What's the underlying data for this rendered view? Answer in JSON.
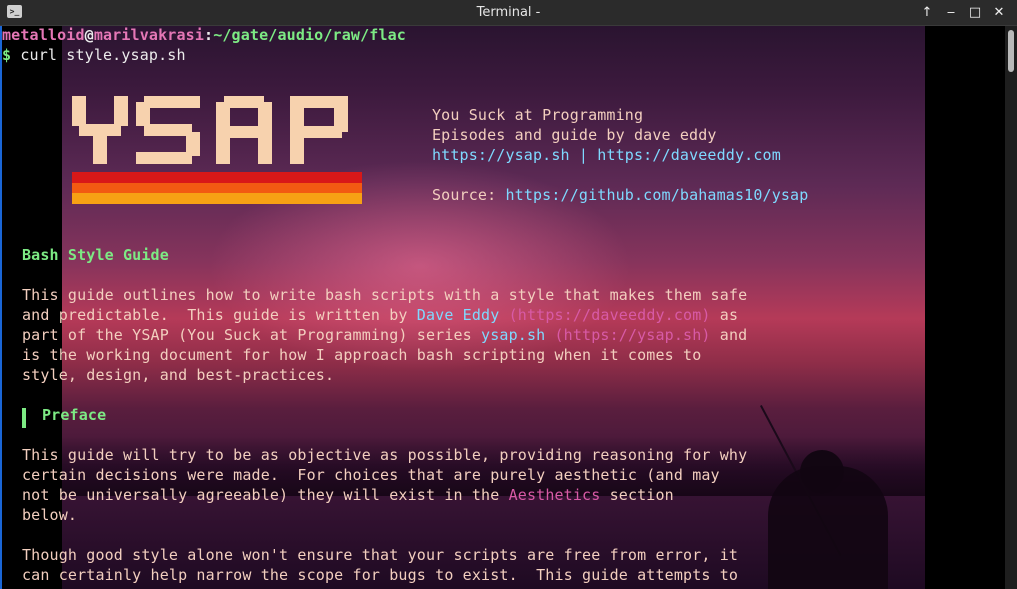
{
  "window": {
    "title": "Terminal - ",
    "icon": "terminal-icon",
    "buttons": [
      "chevron-up-icon",
      "minimize-icon",
      "maximize-icon",
      "close-icon"
    ]
  },
  "prompt": {
    "user": "metalloid",
    "at": "@",
    "host": "marilvakrasi",
    "colon": ":",
    "path": "~/gate/audio/raw/flac",
    "symbol": "$",
    "command": "curl style.ysap.sh"
  },
  "logo": {
    "alt": "YSAP"
  },
  "info": {
    "line1": "You Suck at Programming",
    "line2": "Episodes and guide by dave eddy",
    "link1": "https://ysap.sh",
    "sep": " | ",
    "link2": "https://daveeddy.com",
    "source_label": "Source: ",
    "source_link": "https://github.com/bahamas10/ysap"
  },
  "guide": {
    "title": "Bash Style Guide",
    "p1": {
      "l1": "This guide outlines how to write bash scripts with a style that makes them safe",
      "l2a": "and predictable.  This guide is written by ",
      "l2b": "Dave Eddy",
      "l2c": " (https://daveeddy.com)",
      "l2d": " as",
      "l3a": "part of the YSAP (You Suck at Programming) series ",
      "l3b": "ysap.sh",
      "l3c": " (https://ysap.sh)",
      "l3d": " and",
      "l4": "is the working document for how I approach bash scripting when it comes to",
      "l5": "style, design, and best-practices."
    },
    "preface_heading": "Preface",
    "p2": {
      "l1": "This guide will try to be as objective as possible, providing reasoning for why",
      "l2": "certain decisions were made.  For choices that are purely aesthetic (and may",
      "l3a": "not be universally agreeable) they will exist in the ",
      "l3b": "Aesthetics",
      "l3c": " section",
      "l4": "below."
    },
    "p3": {
      "l1": "Though good style alone won't ensure that your scripts are free from error, it",
      "l2": "can certainly help narrow the scope for bugs to exist.  This guide attempts to"
    }
  },
  "colors": {
    "heading": "#7dea84",
    "link": "#7fd9ff",
    "url": "#d85aa6",
    "body_text": "#f3cfbf"
  }
}
